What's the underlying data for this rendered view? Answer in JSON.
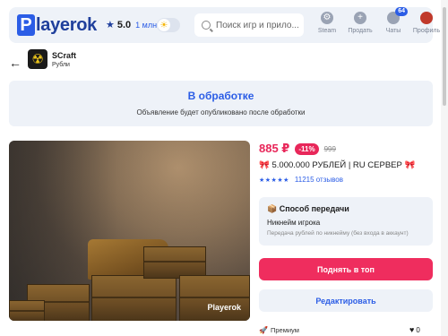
{
  "header": {
    "logo_letter": "P",
    "logo_rest": "layerok",
    "rating_star": "★",
    "rating_value": "5.0",
    "rating_count": "1 млн+",
    "theme_toggle_icon": "sun-icon",
    "search_placeholder": "Поиск игр и прило...",
    "nav": [
      {
        "label": "Steam",
        "icon": "steam-icon"
      },
      {
        "label": "Продать",
        "icon": "plus-icon"
      },
      {
        "label": "Чаты",
        "icon": "chat-icon",
        "badge": "64"
      },
      {
        "label": "Профиль",
        "icon": "avatar-icon"
      }
    ]
  },
  "seller": {
    "name": "SCraft",
    "category": "Рубли"
  },
  "status": {
    "title": "В обработке",
    "description": "Объявление будет опубликовано после обработки"
  },
  "product": {
    "image_brand": "Playerok",
    "price": "885 ₽",
    "discount": "-11%",
    "old_price": "999",
    "title_prefix": "🎀",
    "title": "5.000.000 РУБЛЕЙ | RU СЕРВЕР",
    "title_suffix": "🎀",
    "stars": "★★★★★",
    "reviews": "11215 отзывов",
    "delivery": {
      "title": "Способ передачи",
      "icon": "box-icon",
      "value": "Никнейм игрока",
      "note": "Передача рублей по никнейму (без входа в аккаунт)"
    },
    "raise_button": "Поднять в топ",
    "edit_button": "Редактировать",
    "premium_label": "Премиум",
    "likes": "0"
  },
  "colors": {
    "accent": "#2b5de6",
    "price": "#e8275a",
    "panel": "#eef2f8"
  }
}
